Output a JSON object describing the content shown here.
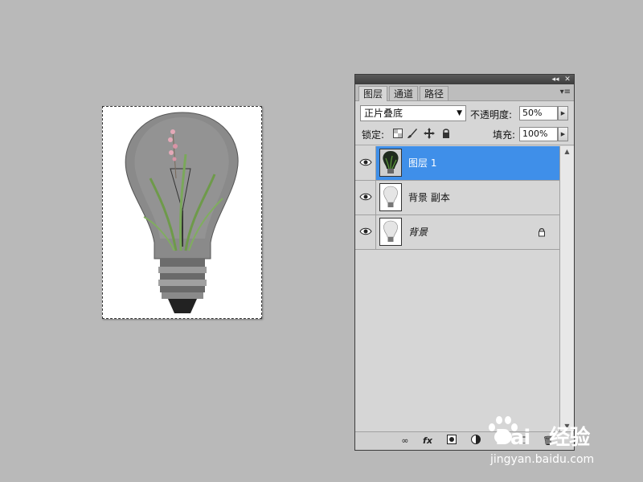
{
  "panel": {
    "tabs": [
      {
        "label": "图层",
        "active": true
      },
      {
        "label": "通道",
        "active": false
      },
      {
        "label": "路径",
        "active": false
      }
    ],
    "collapse_icon": "double-arrow-left-icon",
    "close_icon": "close-icon",
    "menu_icon": "panel-menu-icon",
    "blend_mode": "正片叠底",
    "opacity_label": "不透明度:",
    "opacity_value": "50%",
    "lock_label": "锁定:",
    "fill_label": "填充:",
    "fill_value": "100%",
    "layers": [
      {
        "name": "图层 1",
        "selected": true,
        "visible": true,
        "locked": false,
        "italic": false
      },
      {
        "name": "背景 副本",
        "selected": false,
        "visible": true,
        "locked": false,
        "italic": false
      },
      {
        "name": "背景",
        "selected": false,
        "visible": true,
        "locked": true,
        "italic": true
      }
    ],
    "bottom_tools": [
      "link-layers-icon",
      "fx-icon",
      "layer-mask-icon",
      "adjustment-layer-icon",
      "new-group-icon",
      "new-layer-icon",
      "delete-layer-icon"
    ]
  },
  "colors": {
    "background": "#b9b9b9",
    "selection": "#3f8fe9",
    "panel": "#d6d6d6"
  },
  "watermark": {
    "logo_text": "Bai",
    "logo_text_2": "经验",
    "url": "jingyan.baidu.com"
  }
}
